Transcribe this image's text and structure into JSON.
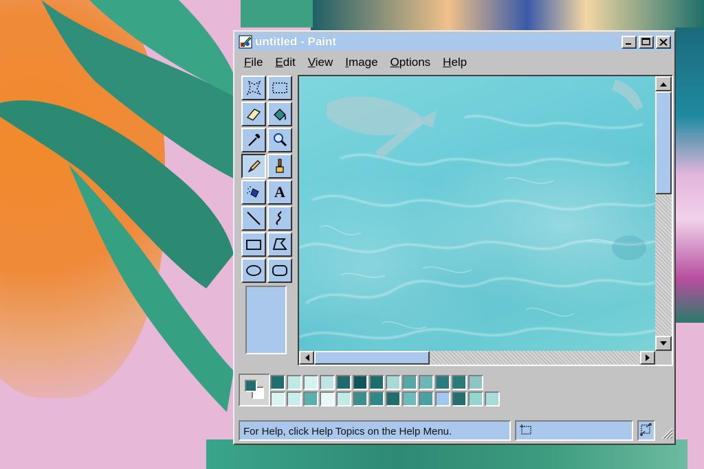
{
  "window": {
    "title": "untitled - Paint",
    "controls": {
      "minimize_icon": "minimize-icon",
      "maximize_icon": "maximize-icon",
      "close_icon": "close-icon"
    }
  },
  "menu": {
    "items": [
      {
        "id": "file",
        "key": "F",
        "rest": "ile"
      },
      {
        "id": "edit",
        "key": "E",
        "rest": "dit"
      },
      {
        "id": "view",
        "key": "V",
        "rest": "iew"
      },
      {
        "id": "image",
        "key": "I",
        "rest": "mage"
      },
      {
        "id": "options",
        "key": "O",
        "rest": "ptions"
      },
      {
        "id": "help",
        "key": "H",
        "rest": "elp"
      }
    ]
  },
  "toolbox": {
    "tools": [
      {
        "name": "free-form-select",
        "icon": "free-select-icon"
      },
      {
        "name": "select",
        "icon": "rect-select-icon"
      },
      {
        "name": "eraser",
        "icon": "eraser-icon"
      },
      {
        "name": "fill-with-color",
        "icon": "paint-bucket-icon"
      },
      {
        "name": "pick-color",
        "icon": "eyedropper-icon"
      },
      {
        "name": "magnifier",
        "icon": "magnifier-icon"
      },
      {
        "name": "pencil",
        "icon": "pencil-icon",
        "selected": true
      },
      {
        "name": "brush",
        "icon": "brush-icon"
      },
      {
        "name": "airbrush",
        "icon": "airbrush-icon"
      },
      {
        "name": "text",
        "icon": "text-icon",
        "glyph": "A"
      },
      {
        "name": "line",
        "icon": "line-icon"
      },
      {
        "name": "curve",
        "icon": "curve-icon"
      },
      {
        "name": "rectangle",
        "icon": "rectangle-icon"
      },
      {
        "name": "polygon",
        "icon": "polygon-icon"
      },
      {
        "name": "ellipse",
        "icon": "ellipse-icon"
      },
      {
        "name": "rounded-rectangle",
        "icon": "rounded-rect-icon"
      }
    ]
  },
  "palette": {
    "foreground": "#1f6f6e",
    "background": "#ffffff",
    "row1": [
      "#1f6f6e",
      "#bfe9e5",
      "#d6f3f1",
      "#bfe4e3",
      "#1e6a6d",
      "#11555c",
      "#1e6e6e",
      "#a7d9d7",
      "#58a7a8",
      "#6db8b6",
      "#2b7b7c",
      "#2a7a78",
      "#8cc7c5"
    ],
    "row2": [
      "#d9f5f2",
      "#c7eeea",
      "#5ab0ad",
      "#e6f9f6",
      "#bfeae6",
      "#3a8f8d",
      "#2f8786",
      "#1f6e6d",
      "#6bbcba",
      "#48a2a0",
      "#9ec8ee",
      "#236f70",
      "#93d6d1",
      "#a8dcd8"
    ]
  },
  "status": {
    "help_text": "For Help, click Help Topics on the Help Menu.",
    "position_icon": "select-position-icon",
    "size_icon": "selection-size-icon"
  },
  "colors": {
    "accent": "#a9c8ec",
    "chrome": "#c3c3c3"
  }
}
